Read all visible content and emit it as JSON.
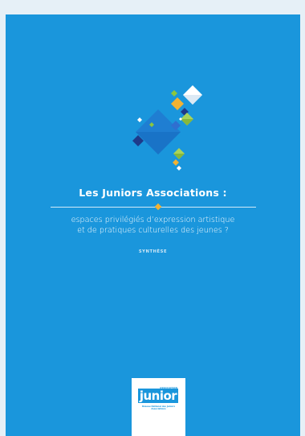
{
  "cover": {
    "title": "Les Juniors Associations :",
    "subtitle_line1": "espaces privilégiés d’expression artistique",
    "subtitle_line2": "et de pratiques culturelles des jeunes ?",
    "tag": "SYNTHÈSE",
    "background_color": "#1a96dc",
    "accent_color": "#f2b233"
  },
  "logo": {
    "small_text": "ASSOCIATION",
    "word": "junior",
    "caption": "Réseau National des Juniors Associations"
  }
}
